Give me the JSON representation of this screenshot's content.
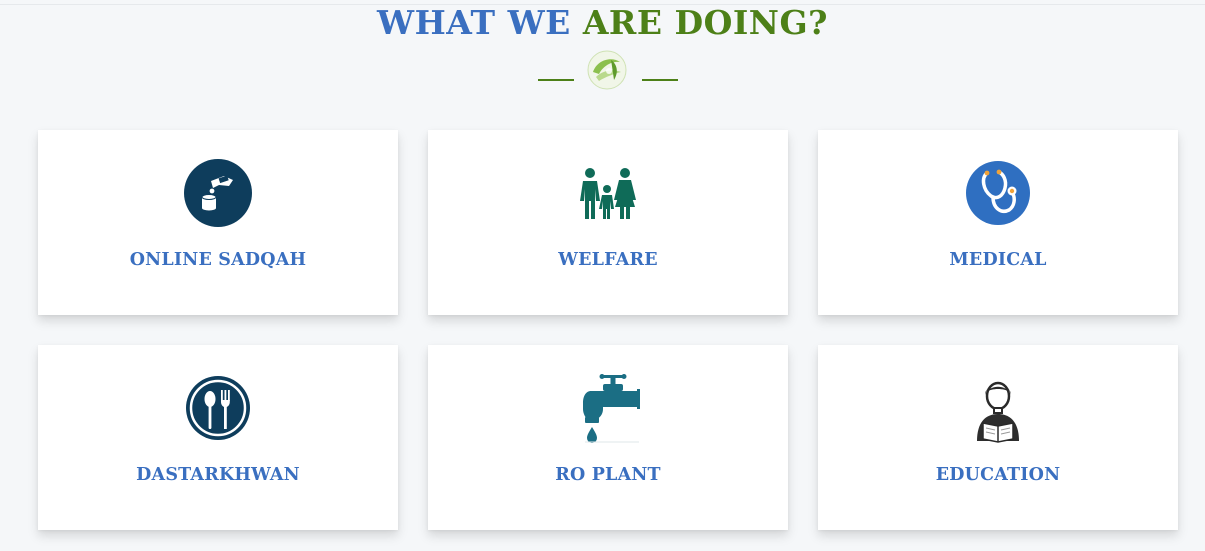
{
  "section": {
    "title_part1": "WHAT WE",
    "title_part2": "ARE DOING?"
  },
  "colors": {
    "title_blue": "#3a6fc0",
    "title_green": "#4d8018",
    "card_label": "#3a6fc0",
    "icon_navy": "#0e3d5c",
    "icon_green": "#0f6b58",
    "icon_blue": "#2f6fc1",
    "icon_teal": "#1b6e84"
  },
  "services": [
    {
      "label": "ONLINE SADQAH",
      "icon": "donation-hand-icon"
    },
    {
      "label": "WELFARE",
      "icon": "family-icon"
    },
    {
      "label": "MEDICAL",
      "icon": "stethoscope-icon"
    },
    {
      "label": "DASTARKHWAN",
      "icon": "spoon-fork-icon"
    },
    {
      "label": "RO PLANT",
      "icon": "water-tap-icon"
    },
    {
      "label": "EDUCATION",
      "icon": "student-reading-icon"
    }
  ]
}
